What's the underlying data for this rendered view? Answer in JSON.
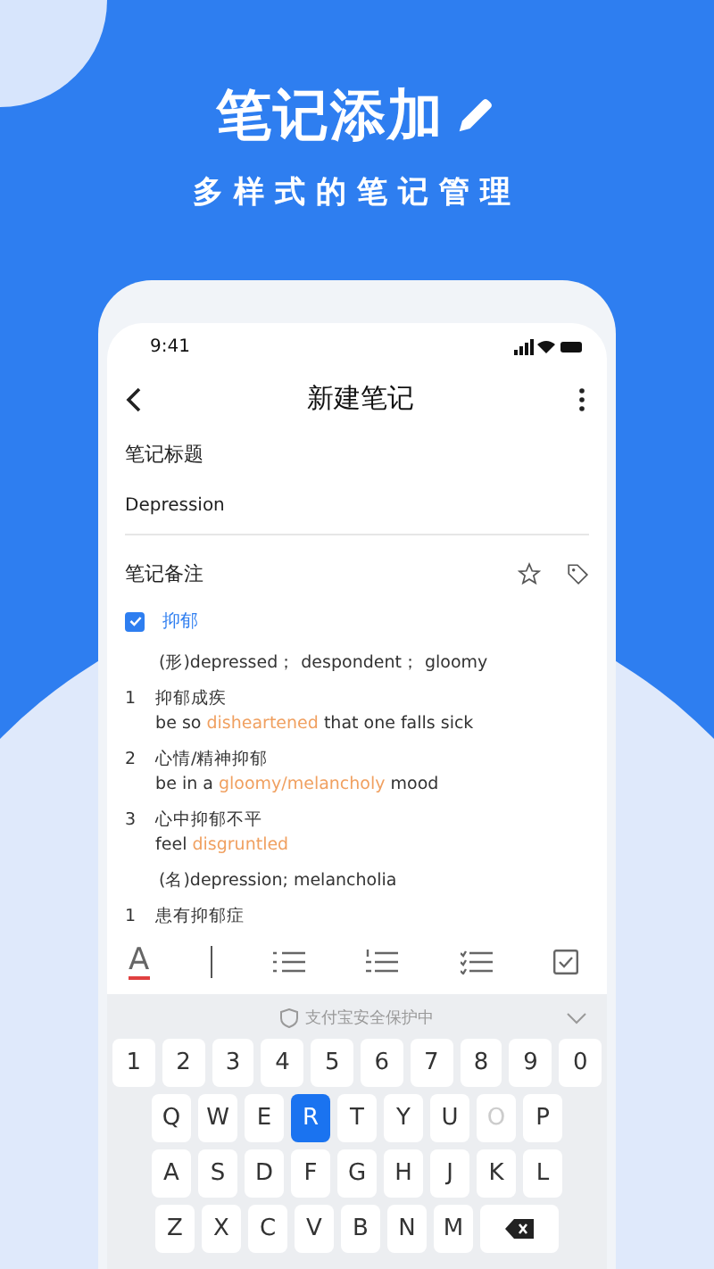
{
  "banner": {
    "title": "笔记添加",
    "subtitle": "多样式的笔记管理"
  },
  "status_bar": {
    "time": "9:41"
  },
  "header": {
    "title": "新建笔记"
  },
  "title_field": {
    "label": "笔记标题",
    "value": "Depression"
  },
  "notes": {
    "label": "笔记备注",
    "word": {
      "text": "抑郁",
      "checked": true
    },
    "entries": [
      {
        "kind": "pos",
        "text": "(形)depressed； despondent； gloomy"
      },
      {
        "kind": "sense",
        "number": "1",
        "cn": "抑郁成疾",
        "en": "be so *disheartened* that one falls sick"
      },
      {
        "kind": "sense",
        "number": "2",
        "cn": "心情/精神抑郁",
        "en": "be in a *gloomy/melancholy* mood"
      },
      {
        "kind": "sense",
        "number": "3",
        "cn": "心中抑郁不平",
        "en": "feel *disgruntled*"
      },
      {
        "kind": "pos",
        "text": "(名)depression; melancholia"
      },
      {
        "kind": "sense",
        "number": "1",
        "cn": "患有抑郁症"
      }
    ]
  },
  "toolbar": {
    "font_button": "A"
  },
  "keyboard": {
    "hint": "支付宝安全保护中",
    "rows": [
      [
        {
          "label": "1",
          "selected": false,
          "dim": false
        },
        {
          "label": "2",
          "selected": false,
          "dim": false
        },
        {
          "label": "3",
          "selected": false,
          "dim": false
        },
        {
          "label": "4",
          "selected": false,
          "dim": false
        },
        {
          "label": "5",
          "selected": false,
          "dim": false
        },
        {
          "label": "6",
          "selected": false,
          "dim": false
        },
        {
          "label": "7",
          "selected": false,
          "dim": false
        },
        {
          "label": "8",
          "selected": false,
          "dim": false
        },
        {
          "label": "9",
          "selected": false,
          "dim": false
        },
        {
          "label": "0",
          "selected": false,
          "dim": false
        }
      ],
      [
        {
          "label": "Q",
          "selected": false,
          "dim": false
        },
        {
          "label": "W",
          "selected": false,
          "dim": false
        },
        {
          "label": "E",
          "selected": false,
          "dim": false
        },
        {
          "label": "R",
          "selected": true,
          "dim": false
        },
        {
          "label": "T",
          "selected": false,
          "dim": false
        },
        {
          "label": "Y",
          "selected": false,
          "dim": false
        },
        {
          "label": "U",
          "selected": false,
          "dim": false
        },
        {
          "label": "O",
          "selected": false,
          "dim": true
        },
        {
          "label": "P",
          "selected": false,
          "dim": false
        }
      ],
      [
        {
          "label": "A",
          "selected": false,
          "dim": false
        },
        {
          "label": "S",
          "selected": false,
          "dim": false
        },
        {
          "label": "D",
          "selected": false,
          "dim": false
        },
        {
          "label": "F",
          "selected": false,
          "dim": false
        },
        {
          "label": "G",
          "selected": false,
          "dim": false
        },
        {
          "label": "H",
          "selected": false,
          "dim": false
        },
        {
          "label": "J",
          "selected": false,
          "dim": false
        },
        {
          "label": "K",
          "selected": false,
          "dim": false
        },
        {
          "label": "L",
          "selected": false,
          "dim": false
        }
      ],
      [
        {
          "label": "Z",
          "selected": false,
          "dim": false
        },
        {
          "label": "X",
          "selected": false,
          "dim": false
        },
        {
          "label": "C",
          "selected": false,
          "dim": false
        },
        {
          "label": "V",
          "selected": false,
          "dim": false
        },
        {
          "label": "B",
          "selected": false,
          "dim": false
        },
        {
          "label": "N",
          "selected": false,
          "dim": false
        },
        {
          "label": "M",
          "selected": false,
          "dim": false
        }
      ]
    ]
  }
}
